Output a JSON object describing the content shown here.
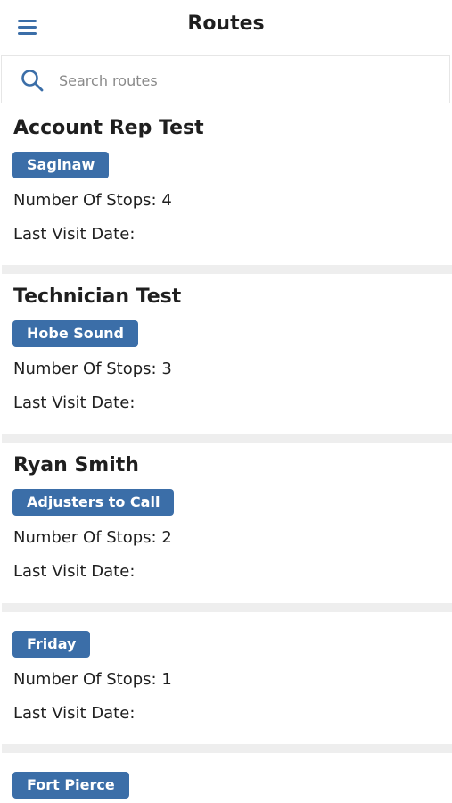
{
  "header": {
    "title": "Routes",
    "menu_icon": "hamburger-menu-icon"
  },
  "search": {
    "placeholder": "Search routes",
    "value": "",
    "icon": "search-icon"
  },
  "colors": {
    "accent": "#3b6ea8",
    "separator": "#eeeeee",
    "text": "#1f1f1f"
  },
  "routes": [
    {
      "name": "Account Rep Test",
      "tag": "Saginaw",
      "stops_label": "Number Of Stops: 4",
      "last_visit_label": "Last Visit Date:"
    },
    {
      "name": "Technician Test",
      "tag": "Hobe Sound",
      "stops_label": "Number Of Stops: 3",
      "last_visit_label": "Last Visit Date:"
    },
    {
      "name": "Ryan Smith",
      "tag": "Adjusters to Call",
      "stops_label": "Number Of Stops: 2",
      "last_visit_label": "Last Visit Date:"
    },
    {
      "name": "",
      "tag": "Friday",
      "stops_label": "Number Of Stops: 1",
      "last_visit_label": "Last Visit Date:"
    },
    {
      "name": "",
      "tag": "Fort Pierce"
    }
  ]
}
